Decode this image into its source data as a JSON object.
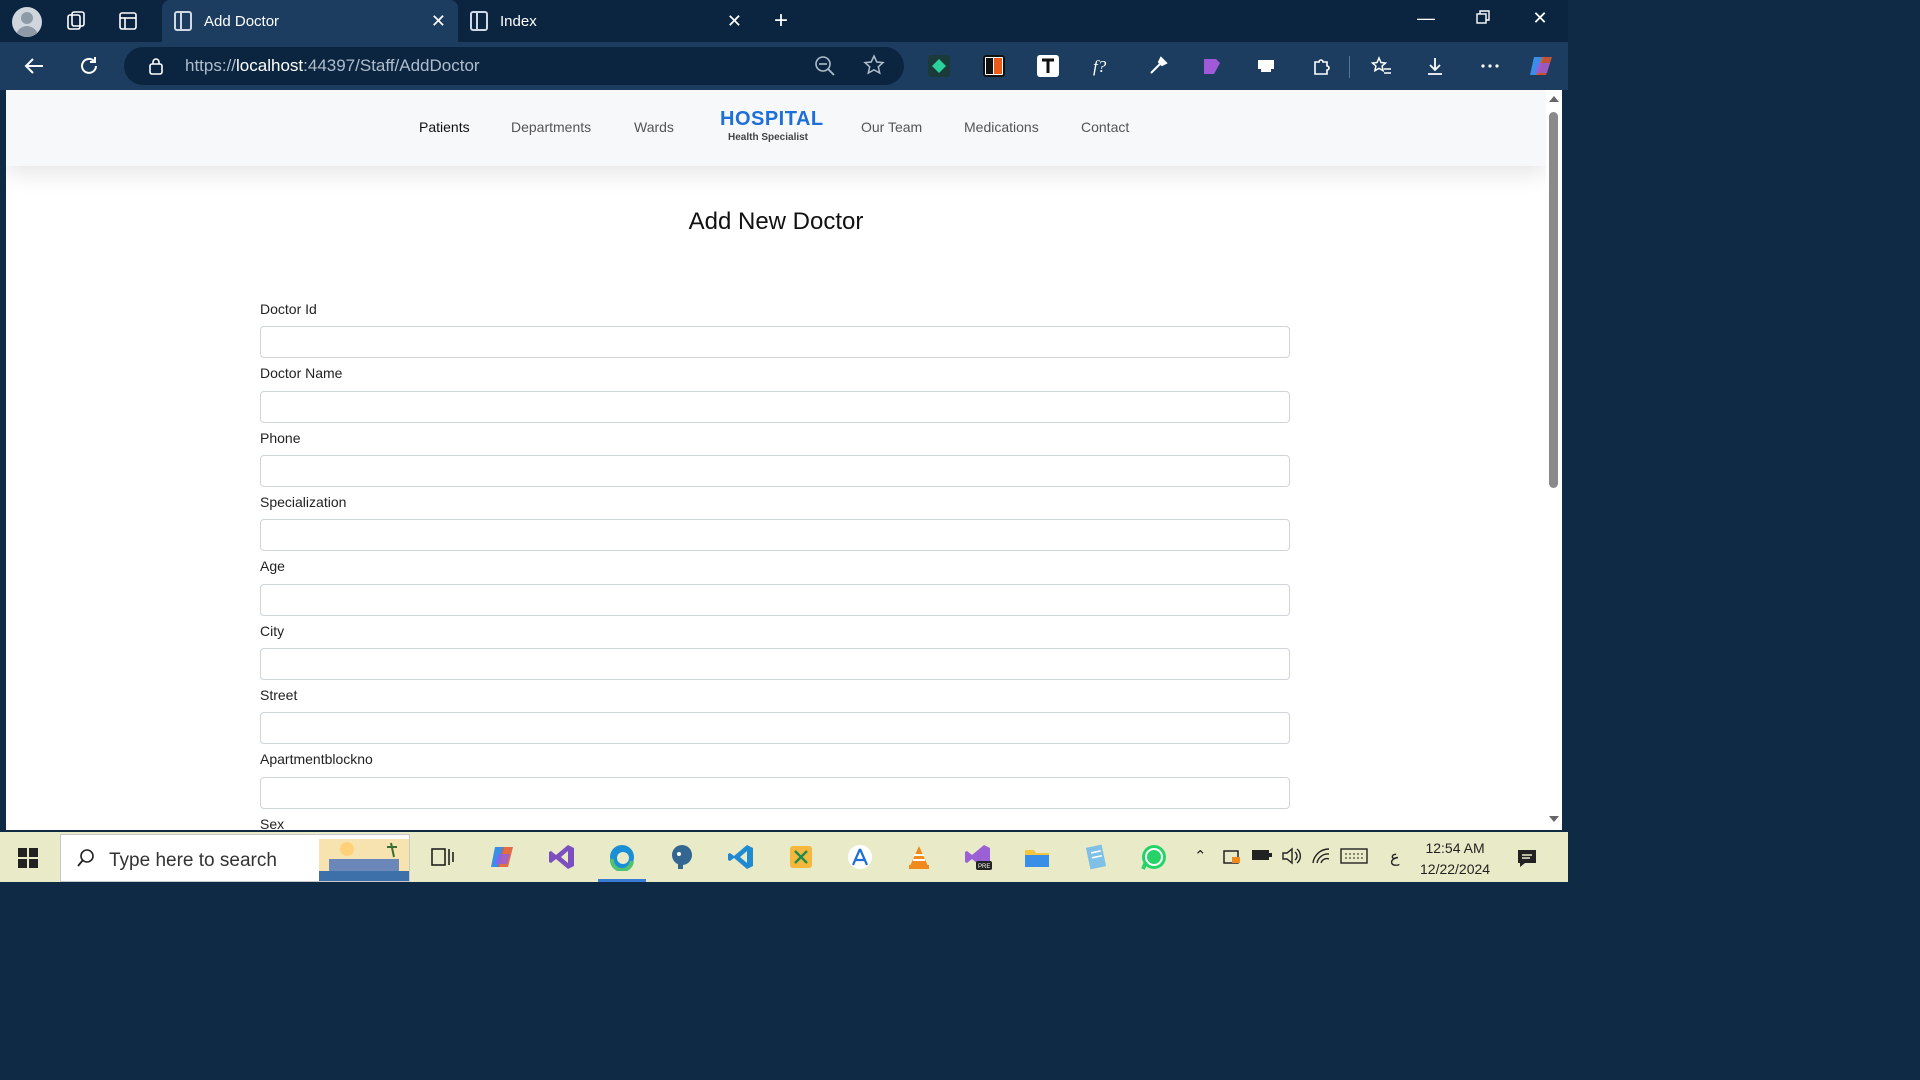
{
  "browser": {
    "tabs": [
      {
        "title": "Add Doctor",
        "active": true
      },
      {
        "title": "Index",
        "active": false
      }
    ],
    "url_prefix": "https://",
    "url_host": "localhost",
    "url_rest": ":44397/Staff/AddDoctor"
  },
  "site": {
    "menu": {
      "patients": "Patients",
      "departments": "Departments",
      "wards": "Wards",
      "our_team": "Our Team",
      "medications": "Medications",
      "contact": "Contact"
    },
    "logo_main": "HOSPITAL",
    "logo_sub": "Health Specialist"
  },
  "form": {
    "title": "Add New Doctor",
    "fields": [
      {
        "label": "Doctor Id",
        "value": ""
      },
      {
        "label": "Doctor Name",
        "value": ""
      },
      {
        "label": "Phone",
        "value": ""
      },
      {
        "label": "Specialization",
        "value": ""
      },
      {
        "label": "Age",
        "value": ""
      },
      {
        "label": "City",
        "value": ""
      },
      {
        "label": "Street",
        "value": ""
      },
      {
        "label": "Apartmentblockno",
        "value": ""
      }
    ],
    "next_label": "Sex"
  },
  "taskbar": {
    "search_placeholder": "Type here to search",
    "time": "12:54 AM",
    "date": "12/22/2024",
    "lang": "ع"
  },
  "colors": {
    "accent": "#1f6fd9",
    "titlebar": "#0b2540",
    "addressbar": "#1c3d60",
    "taskbar": "#e9ebc8"
  }
}
